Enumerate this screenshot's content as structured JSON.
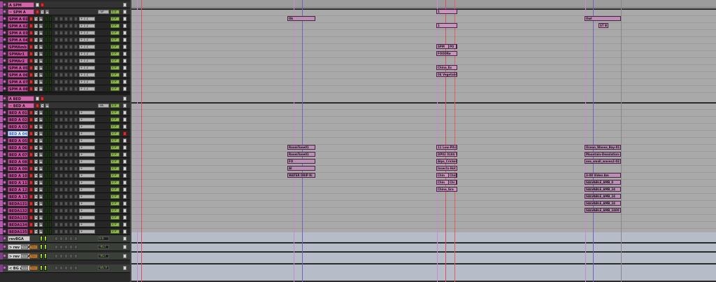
{
  "colors": {
    "track_pink": "#c94fa0",
    "folder_pink": "#d165a8",
    "selected_track": "#e8ecff",
    "io_green": "#8dbb4d",
    "clip": "#c895bd",
    "timeline_bg": "#a9a9a9"
  },
  "tracks": [
    {
      "name": "A SPM",
      "kind": "folder",
      "io": "",
      "vol": ""
    },
    {
      "name": "~ SPM A",
      "kind": "folder",
      "io": "-SP",
      "vol": "0.0"
    },
    {
      "name": "SPM A 01",
      "kind": "track",
      "io": "+ 1 2",
      "vol": "V P"
    },
    {
      "name": "SPM A 02",
      "kind": "track",
      "io": "+ 1 2",
      "vol": "V P"
    },
    {
      "name": "SPM A 03",
      "kind": "track",
      "io": "+ 1 2",
      "vol": "V P"
    },
    {
      "name": "SPM A 04",
      "kind": "track",
      "io": "+ 1 2",
      "vol": "V P"
    },
    {
      "name": "SPMAmb",
      "kind": "track",
      "io": "+ 1 2",
      "vol": "V P"
    },
    {
      "name": "SPMAr1",
      "kind": "track",
      "io": "+ 1 2",
      "vol": "V P"
    },
    {
      "name": "SPMAr2",
      "kind": "track",
      "io": "+ 1 2",
      "vol": "V P"
    },
    {
      "name": "SPM A 05",
      "kind": "track",
      "io": "+ 1 2",
      "vol": "V P"
    },
    {
      "name": "SPM A 06",
      "kind": "track",
      "io": "+ 1 2",
      "vol": "V P"
    },
    {
      "name": "SPM A 07",
      "kind": "track",
      "io": "+ 1 2",
      "vol": "V P"
    },
    {
      "name": "SPM A 08",
      "kind": "track",
      "io": "+ 1 2",
      "vol": "V P"
    },
    {
      "name": "A BED",
      "kind": "folder",
      "io": "",
      "vol": ""
    },
    {
      "name": "~ BED A",
      "kind": "folder",
      "io": "-BE",
      "vol": "0.0"
    },
    {
      "name": "BED A 01",
      "kind": "track",
      "io": "+",
      "vol": "V P"
    },
    {
      "name": "BED A 02",
      "kind": "track",
      "io": "+",
      "vol": "V P"
    },
    {
      "name": "BED A 03",
      "kind": "track",
      "io": "+",
      "vol": "V P"
    },
    {
      "name": "BED A 04",
      "kind": "track",
      "io": "+",
      "vol": "V P",
      "selected": true
    },
    {
      "name": "BED A 05",
      "kind": "track",
      "io": "+",
      "vol": "V P"
    },
    {
      "name": "BED A 06",
      "kind": "track",
      "io": "+",
      "vol": "V P"
    },
    {
      "name": "BED A 07",
      "kind": "track",
      "io": "+",
      "vol": "V P"
    },
    {
      "name": "BED A 08",
      "kind": "track",
      "io": "+",
      "vol": "V P"
    },
    {
      "name": "BED A 09",
      "kind": "track",
      "io": "+",
      "vol": "V P"
    },
    {
      "name": "BED A 10",
      "kind": "track",
      "io": "+",
      "vol": "V P"
    },
    {
      "name": "BED A 11",
      "kind": "track",
      "io": "+",
      "vol": "V P"
    },
    {
      "name": "BED A 12",
      "kind": "track",
      "io": "+",
      "vol": "V P"
    },
    {
      "name": "BED A 13",
      "kind": "track",
      "io": "+",
      "vol": "V P"
    },
    {
      "name": "BEDA131",
      "kind": "track",
      "io": "+",
      "vol": "V P"
    },
    {
      "name": "BEDA132",
      "kind": "track",
      "io": "+",
      "vol": "V P"
    },
    {
      "name": "BEDA133",
      "kind": "track",
      "io": "+",
      "vol": "V P"
    },
    {
      "name": "BEDA134",
      "kind": "track",
      "io": "+",
      "vol": "V P"
    },
    {
      "name": "BEDA135",
      "kind": "track",
      "io": "+",
      "vol": "V P"
    }
  ],
  "aux_tracks": [
    {
      "name": "revBGA",
      "sub": "",
      "io": "0.0",
      "mode": ""
    },
    {
      "name": "> rev BG A tl",
      "sub": "vol",
      "io": "-RGT",
      "mode": "touch"
    },
    {
      "name": "> rev BG A tr",
      "sub": "vol",
      "io": "-RGT",
      "mode": "touch"
    },
    {
      "name": "< BG A",
      "sub": "vol",
      "io": "-BG A",
      "mode": "touch"
    }
  ],
  "clips": [
    {
      "label": "Ok",
      "lane": 2,
      "col": "c1"
    },
    {
      "label": "1",
      "lane": 1,
      "col": "c2"
    },
    {
      "label": "1",
      "lane": 3,
      "col": "c2"
    },
    {
      "label": "SPM",
      "lane": 6,
      "col": "c2"
    },
    {
      "label": "PO",
      "lane": 6,
      "col": "c2b"
    },
    {
      "label": "FOODRe",
      "lane": 7,
      "col": "c2"
    },
    {
      "label": "China_Ex",
      "lane": 9,
      "col": "c2"
    },
    {
      "label": "04 Vegetable",
      "lane": 10,
      "col": "c2"
    },
    {
      "label": "Owl",
      "lane": 2,
      "col": "c3"
    },
    {
      "label": "ST B",
      "lane": 3,
      "col": "c3b"
    },
    {
      "label": "RoomTone01",
      "lane": 20,
      "col": "c1"
    },
    {
      "label": "RoomTone01",
      "lane": 21,
      "col": "c1"
    },
    {
      "label": "FO",
      "lane": 22,
      "col": "c1"
    },
    {
      "label": "Al",
      "lane": 23,
      "col": "c1"
    },
    {
      "label": "WATER DRIP Ri",
      "lane": 24,
      "col": "c1"
    },
    {
      "label": "11 Low-Pitch",
      "lane": 20,
      "col": "c2"
    },
    {
      "label": "DP02 0104 V",
      "lane": 21,
      "col": "c2"
    },
    {
      "label": "Alps_Crickel",
      "lane": 22,
      "col": "c2"
    },
    {
      "label": "Insects-Hot",
      "lane": 23,
      "col": "c2"
    },
    {
      "label": "Chin",
      "lane": 24,
      "col": "c2"
    },
    {
      "label": "China_",
      "lane": 24,
      "col": "c2b"
    },
    {
      "label": "Chin",
      "lane": 25,
      "col": "c2"
    },
    {
      "label": "Chi",
      "lane": 25,
      "col": "c2b"
    },
    {
      "label": "China_Gra",
      "lane": 26,
      "col": "c2"
    },
    {
      "label": "Ocean_Waves_Bay-01",
      "lane": 20,
      "col": "c3"
    },
    {
      "label": "Mountain-Desolation-N",
      "lane": 21,
      "col": "c3"
    },
    {
      "label": "sea_small_waves2-02",
      "lane": 22,
      "col": "c3"
    },
    {
      "label": "3-08 Video Am",
      "lane": 24,
      "col": "c3"
    },
    {
      "label": "SALVABLE_AMB_0",
      "lane": 25,
      "col": "c3"
    },
    {
      "label": "SALVABLE_AMB_24",
      "lane": 26,
      "col": "c3"
    },
    {
      "label": "SALVABLE_AMB_24",
      "lane": 27,
      "col": "c3"
    },
    {
      "label": "SALVABLE_AMB_24",
      "lane": 28,
      "col": "c3"
    },
    {
      "label": "SALVABLE_AMB_2400",
      "lane": 29,
      "col": "c3"
    }
  ],
  "icons": {
    "record": "record-icon",
    "solo": "solo-icon",
    "mute": "mute-icon"
  }
}
